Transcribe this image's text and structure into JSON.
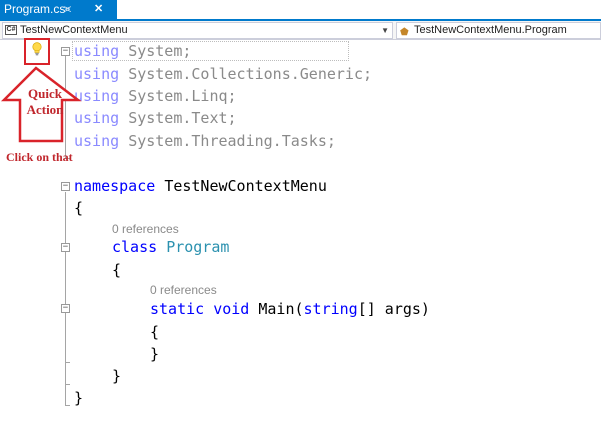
{
  "tab": {
    "title": "Program.cs",
    "pin_icon": "pin-icon",
    "close_icon": "close-icon"
  },
  "navbar": {
    "project_badge": "C#",
    "project": "TestNewContextMenu",
    "type_member": "TestNewContextMenu.Program"
  },
  "code": {
    "using_kw": "using",
    "usings": [
      "System;",
      "System.Collections.Generic;",
      "System.Linq;",
      "System.Text;",
      "System.Threading.Tasks;"
    ],
    "namespace_kw": "namespace",
    "namespace_name": "TestNewContextMenu",
    "open_brace": "{",
    "close_brace": "}",
    "class_refs": "0 references",
    "class_kw": "class",
    "class_name": "Program",
    "method_refs": "0 references",
    "method_static": "static",
    "method_void": "void",
    "method_name": "Main(",
    "method_param_type": "string",
    "method_params_rest": "[] args)"
  },
  "annotation": {
    "quick_action_label": "Quick Action",
    "click_label": "Click on that",
    "color": "#c0262c"
  },
  "colors": {
    "tab_accent": "#007acc",
    "keyword": "#0000ff",
    "type": "#2b91af"
  }
}
